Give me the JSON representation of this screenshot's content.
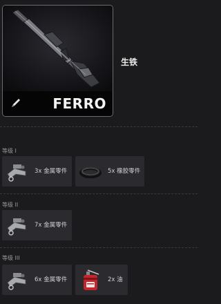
{
  "item": {
    "code": "FERRO",
    "name": "生铁"
  },
  "levels": [
    {
      "label": "等级 I",
      "requirements": [
        {
          "icon": "metal-parts-icon",
          "text": "3x 金属零件"
        },
        {
          "icon": "rubber-parts-icon",
          "text": "5x 橡胶零件"
        }
      ]
    },
    {
      "label": "等级 II",
      "requirements": [
        {
          "icon": "metal-parts-icon",
          "text": "7x 金属零件"
        }
      ]
    },
    {
      "label": "等级 III",
      "requirements": [
        {
          "icon": "metal-parts-icon",
          "text": "6x 金属零件"
        },
        {
          "icon": "oil-can-icon",
          "text": "2x 油"
        }
      ]
    }
  ]
}
